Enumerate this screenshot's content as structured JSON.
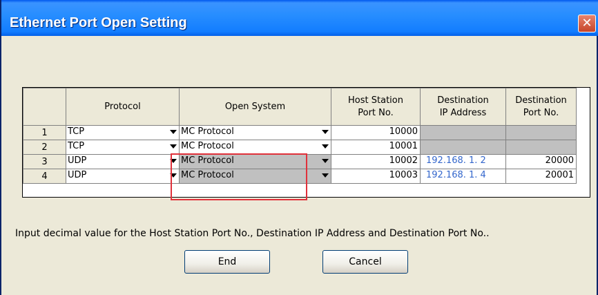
{
  "dialog": {
    "title": "Ethernet Port Open Setting",
    "close_icon": "close-icon",
    "hint": "Input decimal value for the Host Station Port No., Destination IP Address and Destination Port No..",
    "buttons": {
      "end": "End",
      "cancel": "Cancel"
    }
  },
  "table": {
    "headers": {
      "protocol": "Protocol",
      "open_system": "Open System",
      "host_port_l1": "Host Station",
      "host_port_l2": "Port No.",
      "dest_ip_l1": "Destination",
      "dest_ip_l2": "IP Address",
      "dest_port_l1": "Destination",
      "dest_port_l2": "Port No."
    },
    "rows": [
      {
        "num": "1",
        "protocol": "TCP",
        "open_system": "MC Protocol",
        "host_port": "10000",
        "dest_ip": "",
        "dest_port": ""
      },
      {
        "num": "2",
        "protocol": "TCP",
        "open_system": "MC Protocol",
        "host_port": "10001",
        "dest_ip": "",
        "dest_port": ""
      },
      {
        "num": "3",
        "protocol": "UDP",
        "open_system": "MC Protocol",
        "host_port": "10002",
        "dest_ip": "192.168.  1.  2",
        "dest_port": "20000"
      },
      {
        "num": "4",
        "protocol": "UDP",
        "open_system": "MC Protocol",
        "host_port": "10003",
        "dest_ip": "192.168.  1.  4",
        "dest_port": "20001"
      }
    ]
  },
  "colors": {
    "titlebar": "#288eff",
    "highlight": "#e0303a",
    "ip_text": "#3366cc",
    "disabled_cell": "#c0c0c0"
  }
}
